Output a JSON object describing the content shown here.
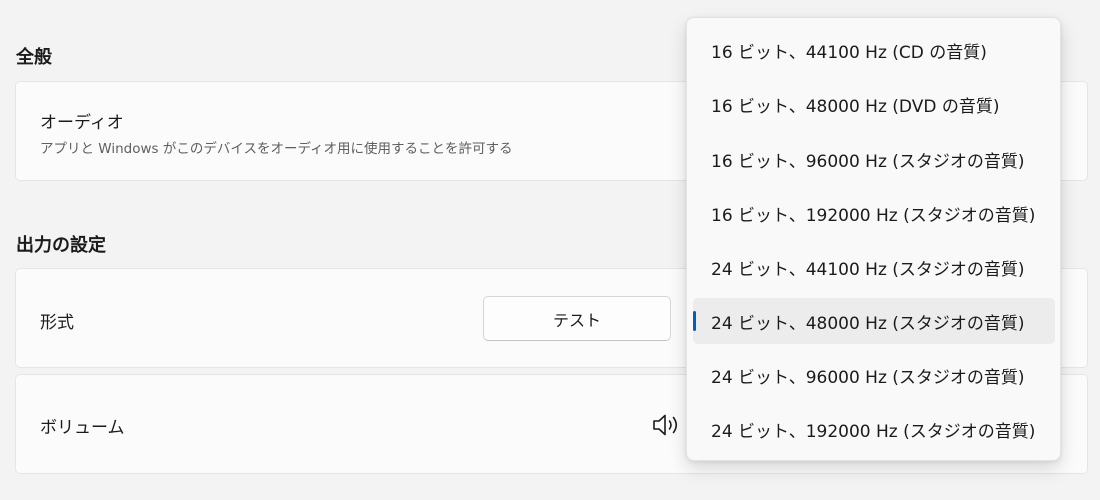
{
  "general": {
    "title": "全般",
    "audio_title": "オーディオ",
    "audio_desc": "アプリと Windows がこのデバイスをオーディオ用に使用することを許可する"
  },
  "output": {
    "title": "出力の設定",
    "format_label": "形式",
    "test_button": "テスト",
    "volume_label": "ボリューム",
    "volume_icon": "speaker-icon"
  },
  "format_dropdown": {
    "options": [
      "16 ビット、44100 Hz (CD の音質)",
      "16 ビット、48000 Hz (DVD の音質)",
      "16 ビット、96000 Hz (スタジオの音質)",
      "16 ビット、192000 Hz (スタジオの音質)",
      "24 ビット、44100 Hz (スタジオの音質)",
      "24 ビット、48000 Hz (スタジオの音質)",
      "24 ビット、96000 Hz (スタジオの音質)",
      "24 ビット、192000 Hz (スタジオの音質)"
    ],
    "selected_index": 5,
    "accent_color": "#005fb8"
  }
}
